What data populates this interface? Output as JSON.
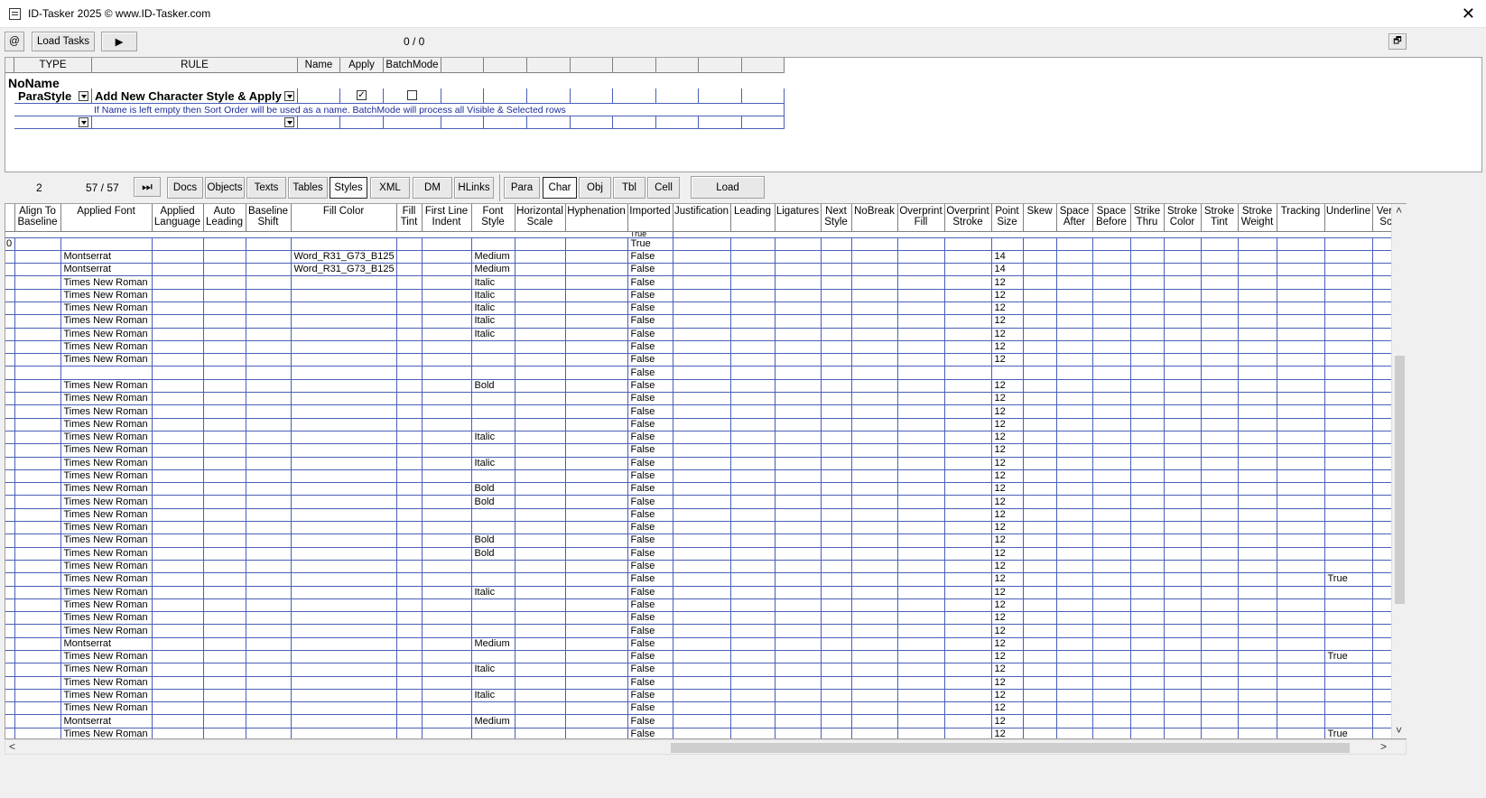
{
  "window": {
    "title": "ID-Tasker 2025  © www.ID-Tasker.com",
    "close": "✕"
  },
  "toolbar1": {
    "at": "@",
    "load_tasks": "Load Tasks",
    "play": "▶",
    "counter": "0 / 0",
    "restore": "🗗"
  },
  "rules": {
    "headers": [
      "TYPE",
      "RULE",
      "Name",
      "Apply",
      "BatchMode"
    ],
    "group": "NoName",
    "type_value": "ParaStyle",
    "rule_value": "Add New Character Style & Apply",
    "apply_checked": "✓",
    "note": "If Name is left empty then Sort Order will be used as a name. BatchMode will process all Visible & Selected rows"
  },
  "toolbar2": {
    "num": "2",
    "counter": "57 / 57",
    "ff": "⏭",
    "tabs": [
      "Docs",
      "Objects",
      "Texts",
      "Tables",
      "Styles",
      "XML",
      "DM",
      "HLinks"
    ],
    "subtabs": [
      "Para",
      "Char",
      "Obj",
      "Tbl",
      "Cell"
    ],
    "load": "Load"
  },
  "grid": {
    "columns": [
      "",
      "Align To Baseline",
      "Applied Font",
      "Applied Language",
      "Auto Leading",
      "Baseline Shift",
      "Fill Color",
      "Fill Tint",
      "First Line Indent",
      "Font Style",
      "Horizontal Scale",
      "Hyphenation",
      "Imported",
      "Justification",
      "Leading",
      "Ligatures",
      "Next Style",
      "NoBreak",
      "Overprint Fill",
      "Overprint Stroke",
      "Point Size",
      "Skew",
      "Space After",
      "Space Before",
      "Strike Thru",
      "Stroke Color",
      "Stroke Tint",
      "Stroke Weight",
      "Tracking",
      "Underline",
      "Vert Sc"
    ],
    "partial_row": "True",
    "rows": [
      [
        "0",
        "",
        "",
        "",
        "",
        "",
        "",
        "",
        "",
        "",
        "",
        "",
        "True",
        "",
        "",
        "",
        "",
        "",
        "",
        "",
        "",
        "",
        "",
        "",
        "",
        "",
        "",
        "",
        "",
        "",
        ""
      ],
      [
        "",
        "",
        "Montserrat",
        "",
        "",
        "",
        "Word_R31_G73_B125",
        "",
        "",
        "Medium",
        "",
        "",
        "False",
        "",
        "",
        "",
        "",
        "",
        "",
        "",
        "14",
        "",
        "",
        "",
        "",
        "",
        "",
        "",
        "",
        "",
        ""
      ],
      [
        "",
        "",
        "Montserrat",
        "",
        "",
        "",
        "Word_R31_G73_B125",
        "",
        "",
        "Medium",
        "",
        "",
        "False",
        "",
        "",
        "",
        "",
        "",
        "",
        "",
        "14",
        "",
        "",
        "",
        "",
        "",
        "",
        "",
        "",
        "",
        ""
      ],
      [
        "",
        "",
        "Times New Roman",
        "",
        "",
        "",
        "",
        "",
        "",
        "Italic",
        "",
        "",
        "False",
        "",
        "",
        "",
        "",
        "",
        "",
        "",
        "12",
        "",
        "",
        "",
        "",
        "",
        "",
        "",
        "",
        "",
        ""
      ],
      [
        "",
        "",
        "Times New Roman",
        "",
        "",
        "",
        "",
        "",
        "",
        "Italic",
        "",
        "",
        "False",
        "",
        "",
        "",
        "",
        "",
        "",
        "",
        "12",
        "",
        "",
        "",
        "",
        "",
        "",
        "",
        "",
        "",
        ""
      ],
      [
        "",
        "",
        "Times New Roman",
        "",
        "",
        "",
        "",
        "",
        "",
        "Italic",
        "",
        "",
        "False",
        "",
        "",
        "",
        "",
        "",
        "",
        "",
        "12",
        "",
        "",
        "",
        "",
        "",
        "",
        "",
        "",
        "",
        ""
      ],
      [
        "",
        "",
        "Times New Roman",
        "",
        "",
        "",
        "",
        "",
        "",
        "Italic",
        "",
        "",
        "False",
        "",
        "",
        "",
        "",
        "",
        "",
        "",
        "12",
        "",
        "",
        "",
        "",
        "",
        "",
        "",
        "",
        "",
        ""
      ],
      [
        "",
        "",
        "Times New Roman",
        "",
        "",
        "",
        "",
        "",
        "",
        "Italic",
        "",
        "",
        "False",
        "",
        "",
        "",
        "",
        "",
        "",
        "",
        "12",
        "",
        "",
        "",
        "",
        "",
        "",
        "",
        "",
        "",
        ""
      ],
      [
        "",
        "",
        "Times New Roman",
        "",
        "",
        "",
        "",
        "",
        "",
        "",
        "",
        "",
        "False",
        "",
        "",
        "",
        "",
        "",
        "",
        "",
        "12",
        "",
        "",
        "",
        "",
        "",
        "",
        "",
        "",
        "",
        ""
      ],
      [
        "",
        "",
        "Times New Roman",
        "",
        "",
        "",
        "",
        "",
        "",
        "",
        "",
        "",
        "False",
        "",
        "",
        "",
        "",
        "",
        "",
        "",
        "12",
        "",
        "",
        "",
        "",
        "",
        "",
        "",
        "",
        "",
        ""
      ],
      [
        "",
        "",
        "",
        "",
        "",
        "",
        "",
        "",
        "",
        "",
        "",
        "",
        "False",
        "",
        "",
        "",
        "",
        "",
        "",
        "",
        "",
        "",
        "",
        "",
        "",
        "",
        "",
        "",
        "",
        "",
        ""
      ],
      [
        "",
        "",
        "Times New Roman",
        "",
        "",
        "",
        "",
        "",
        "",
        "Bold",
        "",
        "",
        "False",
        "",
        "",
        "",
        "",
        "",
        "",
        "",
        "12",
        "",
        "",
        "",
        "",
        "",
        "",
        "",
        "",
        "",
        ""
      ],
      [
        "",
        "",
        "Times New Roman",
        "",
        "",
        "",
        "",
        "",
        "",
        "",
        "",
        "",
        "False",
        "",
        "",
        "",
        "",
        "",
        "",
        "",
        "12",
        "",
        "",
        "",
        "",
        "",
        "",
        "",
        "",
        "",
        ""
      ],
      [
        "",
        "",
        "Times New Roman",
        "",
        "",
        "",
        "",
        "",
        "",
        "",
        "",
        "",
        "False",
        "",
        "",
        "",
        "",
        "",
        "",
        "",
        "12",
        "",
        "",
        "",
        "",
        "",
        "",
        "",
        "",
        "",
        ""
      ],
      [
        "",
        "",
        "Times New Roman",
        "",
        "",
        "",
        "",
        "",
        "",
        "",
        "",
        "",
        "False",
        "",
        "",
        "",
        "",
        "",
        "",
        "",
        "12",
        "",
        "",
        "",
        "",
        "",
        "",
        "",
        "",
        "",
        ""
      ],
      [
        "",
        "",
        "Times New Roman",
        "",
        "",
        "",
        "",
        "",
        "",
        "Italic",
        "",
        "",
        "False",
        "",
        "",
        "",
        "",
        "",
        "",
        "",
        "12",
        "",
        "",
        "",
        "",
        "",
        "",
        "",
        "",
        "",
        ""
      ],
      [
        "",
        "",
        "Times New Roman",
        "",
        "",
        "",
        "",
        "",
        "",
        "",
        "",
        "",
        "False",
        "",
        "",
        "",
        "",
        "",
        "",
        "",
        "12",
        "",
        "",
        "",
        "",
        "",
        "",
        "",
        "",
        "",
        ""
      ],
      [
        "",
        "",
        "Times New Roman",
        "",
        "",
        "",
        "",
        "",
        "",
        "Italic",
        "",
        "",
        "False",
        "",
        "",
        "",
        "",
        "",
        "",
        "",
        "12",
        "",
        "",
        "",
        "",
        "",
        "",
        "",
        "",
        "",
        ""
      ],
      [
        "",
        "",
        "Times New Roman",
        "",
        "",
        "",
        "",
        "",
        "",
        "",
        "",
        "",
        "False",
        "",
        "",
        "",
        "",
        "",
        "",
        "",
        "12",
        "",
        "",
        "",
        "",
        "",
        "",
        "",
        "",
        "",
        ""
      ],
      [
        "",
        "",
        "Times New Roman",
        "",
        "",
        "",
        "",
        "",
        "",
        "Bold",
        "",
        "",
        "False",
        "",
        "",
        "",
        "",
        "",
        "",
        "",
        "12",
        "",
        "",
        "",
        "",
        "",
        "",
        "",
        "",
        "",
        ""
      ],
      [
        "",
        "",
        "Times New Roman",
        "",
        "",
        "",
        "",
        "",
        "",
        "Bold",
        "",
        "",
        "False",
        "",
        "",
        "",
        "",
        "",
        "",
        "",
        "12",
        "",
        "",
        "",
        "",
        "",
        "",
        "",
        "",
        "",
        ""
      ],
      [
        "",
        "",
        "Times New Roman",
        "",
        "",
        "",
        "",
        "",
        "",
        "",
        "",
        "",
        "False",
        "",
        "",
        "",
        "",
        "",
        "",
        "",
        "12",
        "",
        "",
        "",
        "",
        "",
        "",
        "",
        "",
        "",
        ""
      ],
      [
        "",
        "",
        "Times New Roman",
        "",
        "",
        "",
        "",
        "",
        "",
        "",
        "",
        "",
        "False",
        "",
        "",
        "",
        "",
        "",
        "",
        "",
        "12",
        "",
        "",
        "",
        "",
        "",
        "",
        "",
        "",
        "",
        ""
      ],
      [
        "",
        "",
        "Times New Roman",
        "",
        "",
        "",
        "",
        "",
        "",
        "Bold",
        "",
        "",
        "False",
        "",
        "",
        "",
        "",
        "",
        "",
        "",
        "12",
        "",
        "",
        "",
        "",
        "",
        "",
        "",
        "",
        "",
        ""
      ],
      [
        "",
        "",
        "Times New Roman",
        "",
        "",
        "",
        "",
        "",
        "",
        "Bold",
        "",
        "",
        "False",
        "",
        "",
        "",
        "",
        "",
        "",
        "",
        "12",
        "",
        "",
        "",
        "",
        "",
        "",
        "",
        "",
        "",
        ""
      ],
      [
        "",
        "",
        "Times New Roman",
        "",
        "",
        "",
        "",
        "",
        "",
        "",
        "",
        "",
        "False",
        "",
        "",
        "",
        "",
        "",
        "",
        "",
        "12",
        "",
        "",
        "",
        "",
        "",
        "",
        "",
        "",
        "",
        ""
      ],
      [
        "",
        "",
        "Times New Roman",
        "",
        "",
        "",
        "",
        "",
        "",
        "",
        "",
        "",
        "False",
        "",
        "",
        "",
        "",
        "",
        "",
        "",
        "12",
        "",
        "",
        "",
        "",
        "",
        "",
        "",
        "",
        "True",
        ""
      ],
      [
        "",
        "",
        "Times New Roman",
        "",
        "",
        "",
        "",
        "",
        "",
        "Italic",
        "",
        "",
        "False",
        "",
        "",
        "",
        "",
        "",
        "",
        "",
        "12",
        "",
        "",
        "",
        "",
        "",
        "",
        "",
        "",
        "",
        ""
      ],
      [
        "",
        "",
        "Times New Roman",
        "",
        "",
        "",
        "",
        "",
        "",
        "",
        "",
        "",
        "False",
        "",
        "",
        "",
        "",
        "",
        "",
        "",
        "12",
        "",
        "",
        "",
        "",
        "",
        "",
        "",
        "",
        "",
        ""
      ],
      [
        "",
        "",
        "Times New Roman",
        "",
        "",
        "",
        "",
        "",
        "",
        "",
        "",
        "",
        "False",
        "",
        "",
        "",
        "",
        "",
        "",
        "",
        "12",
        "",
        "",
        "",
        "",
        "",
        "",
        "",
        "",
        "",
        ""
      ],
      [
        "",
        "",
        "Times New Roman",
        "",
        "",
        "",
        "",
        "",
        "",
        "",
        "",
        "",
        "False",
        "",
        "",
        "",
        "",
        "",
        "",
        "",
        "12",
        "",
        "",
        "",
        "",
        "",
        "",
        "",
        "",
        "",
        ""
      ],
      [
        "",
        "",
        "Montserrat",
        "",
        "",
        "",
        "",
        "",
        "",
        "Medium",
        "",
        "",
        "False",
        "",
        "",
        "",
        "",
        "",
        "",
        "",
        "12",
        "",
        "",
        "",
        "",
        "",
        "",
        "",
        "",
        "",
        ""
      ],
      [
        "",
        "",
        "Times New Roman",
        "",
        "",
        "",
        "",
        "",
        "",
        "",
        "",
        "",
        "False",
        "",
        "",
        "",
        "",
        "",
        "",
        "",
        "12",
        "",
        "",
        "",
        "",
        "",
        "",
        "",
        "",
        "True",
        ""
      ],
      [
        "",
        "",
        "Times New Roman",
        "",
        "",
        "",
        "",
        "",
        "",
        "Italic",
        "",
        "",
        "False",
        "",
        "",
        "",
        "",
        "",
        "",
        "",
        "12",
        "",
        "",
        "",
        "",
        "",
        "",
        "",
        "",
        "",
        ""
      ],
      [
        "",
        "",
        "Times New Roman",
        "",
        "",
        "",
        "",
        "",
        "",
        "",
        "",
        "",
        "False",
        "",
        "",
        "",
        "",
        "",
        "",
        "",
        "12",
        "",
        "",
        "",
        "",
        "",
        "",
        "",
        "",
        "",
        ""
      ],
      [
        "",
        "",
        "Times New Roman",
        "",
        "",
        "",
        "",
        "",
        "",
        "Italic",
        "",
        "",
        "False",
        "",
        "",
        "",
        "",
        "",
        "",
        "",
        "12",
        "",
        "",
        "",
        "",
        "",
        "",
        "",
        "",
        "",
        ""
      ],
      [
        "",
        "",
        "Times New Roman",
        "",
        "",
        "",
        "",
        "",
        "",
        "",
        "",
        "",
        "False",
        "",
        "",
        "",
        "",
        "",
        "",
        "",
        "12",
        "",
        "",
        "",
        "",
        "",
        "",
        "",
        "",
        "",
        ""
      ],
      [
        "",
        "",
        "Montserrat",
        "",
        "",
        "",
        "",
        "",
        "",
        "Medium",
        "",
        "",
        "False",
        "",
        "",
        "",
        "",
        "",
        "",
        "",
        "12",
        "",
        "",
        "",
        "",
        "",
        "",
        "",
        "",
        "",
        ""
      ],
      [
        "",
        "",
        "Times New Roman",
        "",
        "",
        "",
        "",
        "",
        "",
        "",
        "",
        "",
        "False",
        "",
        "",
        "",
        "",
        "",
        "",
        "",
        "12",
        "",
        "",
        "",
        "",
        "",
        "",
        "",
        "",
        "True",
        ""
      ]
    ]
  }
}
